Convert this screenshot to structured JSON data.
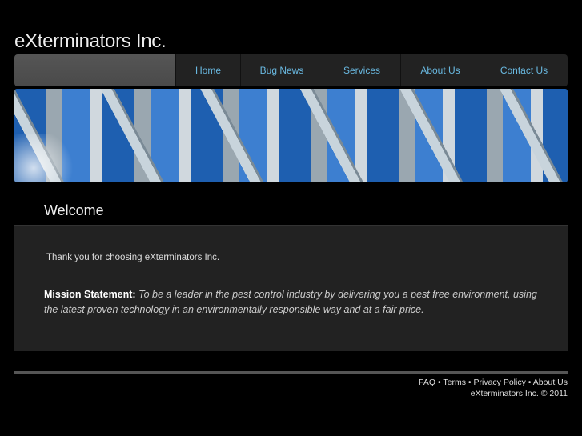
{
  "site": {
    "title": "eXterminators Inc."
  },
  "nav": [
    "Home",
    "Bug News",
    "Services",
    "About Us",
    "Contact Us"
  ],
  "main": {
    "heading": "Welcome",
    "thanks": "Thank you for choosing eXterminators Inc.",
    "mission_label": "Mission Statement:",
    "mission_text": "To be a leader in the pest control industry by delivering you a pest free environment, using the latest proven technology in an environmentally responsible way and at a fair price."
  },
  "footer": {
    "links": [
      "FAQ",
      "Terms",
      "Privacy Policy",
      "About Us"
    ],
    "sep": " • ",
    "copyright": "eXterminators Inc. © 2011"
  }
}
